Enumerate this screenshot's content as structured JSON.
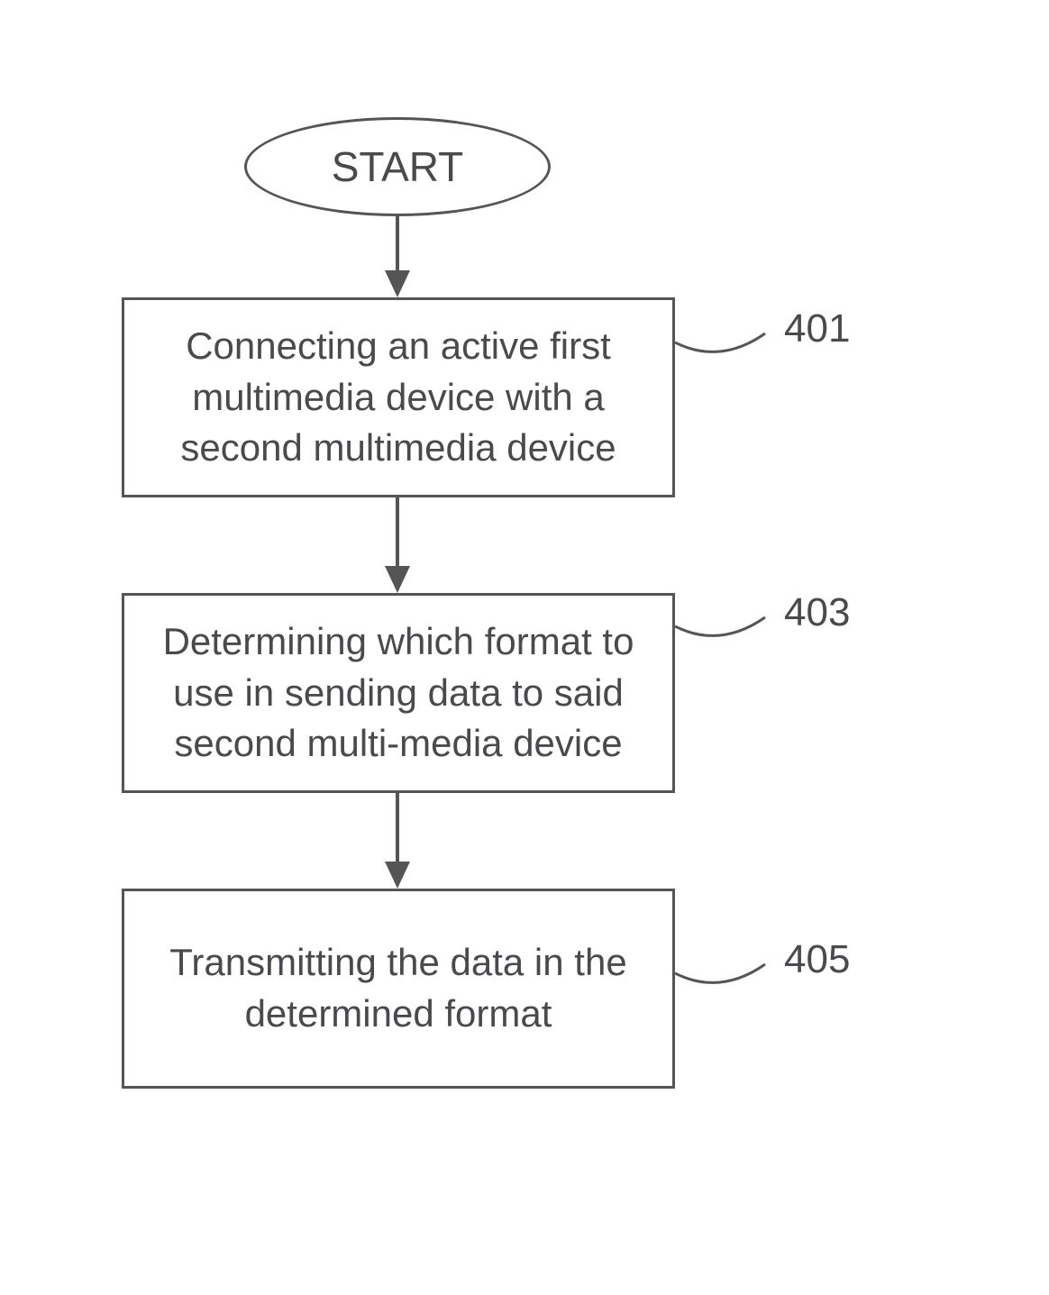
{
  "flowchart": {
    "start": {
      "label": "START"
    },
    "steps": [
      {
        "text": "Connecting an active first multimedia device with a second multimedia device",
        "ref": "401"
      },
      {
        "text": "Determining which format to use in sending data to said second multi-media device",
        "ref": "403"
      },
      {
        "text": "Transmitting the data in the determined format",
        "ref": "405"
      }
    ]
  }
}
